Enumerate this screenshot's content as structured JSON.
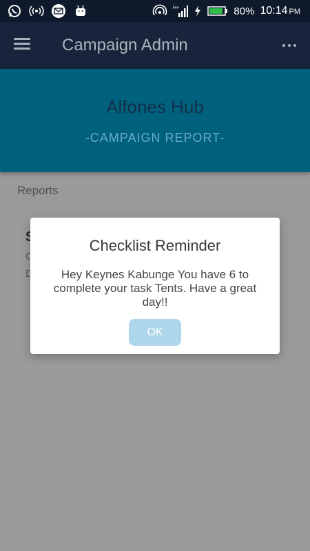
{
  "status_bar": {
    "left_icons": [
      "whatsapp-icon",
      "hotspot-icon",
      "mail-icon",
      "android-icon"
    ],
    "right_icons": [
      "wifi-hotspot-icon",
      "signal-icon",
      "charging-icon",
      "battery-icon"
    ],
    "battery": "80%",
    "time": "10:14",
    "ampm": "PM"
  },
  "app_bar": {
    "title": "Campaign Admin",
    "menu_icon": "hamburger-menu-icon",
    "more_icon": "more-horizontal-icon"
  },
  "hero": {
    "title": "Alfones Hub",
    "subtitle": "-CAMPAIGN REPORT-"
  },
  "main": {
    "section_label": "Reports",
    "card": {
      "title_initial": "S",
      "line1_initial": "C",
      "line2_initial": "D"
    }
  },
  "dialog": {
    "title": "Checklist Reminder",
    "message": "Hey Keynes Kabunge You have 6 to complete your task Tents. Have a great day!!",
    "ok_label": "OK"
  },
  "colors": {
    "status_bar_bg": "#0e1a2b",
    "app_bar_bg": "#17243b",
    "hero_bg": "#00617f",
    "overlay_bg": "#9a9a9a",
    "ok_button_bg": "#aed6ea"
  }
}
